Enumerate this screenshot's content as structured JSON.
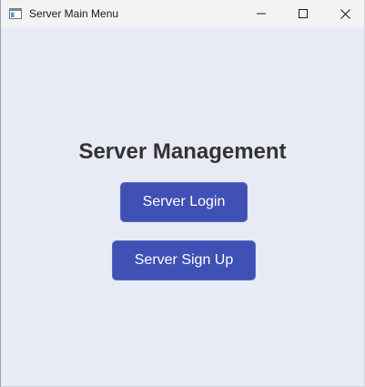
{
  "window": {
    "title": "Server Main Menu",
    "icon": "app-window-icon",
    "controls": {
      "minimize_icon": "minimize-icon",
      "maximize_icon": "maximize-icon",
      "close_icon": "close-icon"
    }
  },
  "main": {
    "heading": "Server Management",
    "buttons": {
      "login_label": "Server Login",
      "signup_label": "Server Sign Up"
    }
  },
  "colors": {
    "background": "#e8eaf6",
    "button": "#3f51b5",
    "heading_text": "#333333",
    "button_text": "#ffffff"
  }
}
